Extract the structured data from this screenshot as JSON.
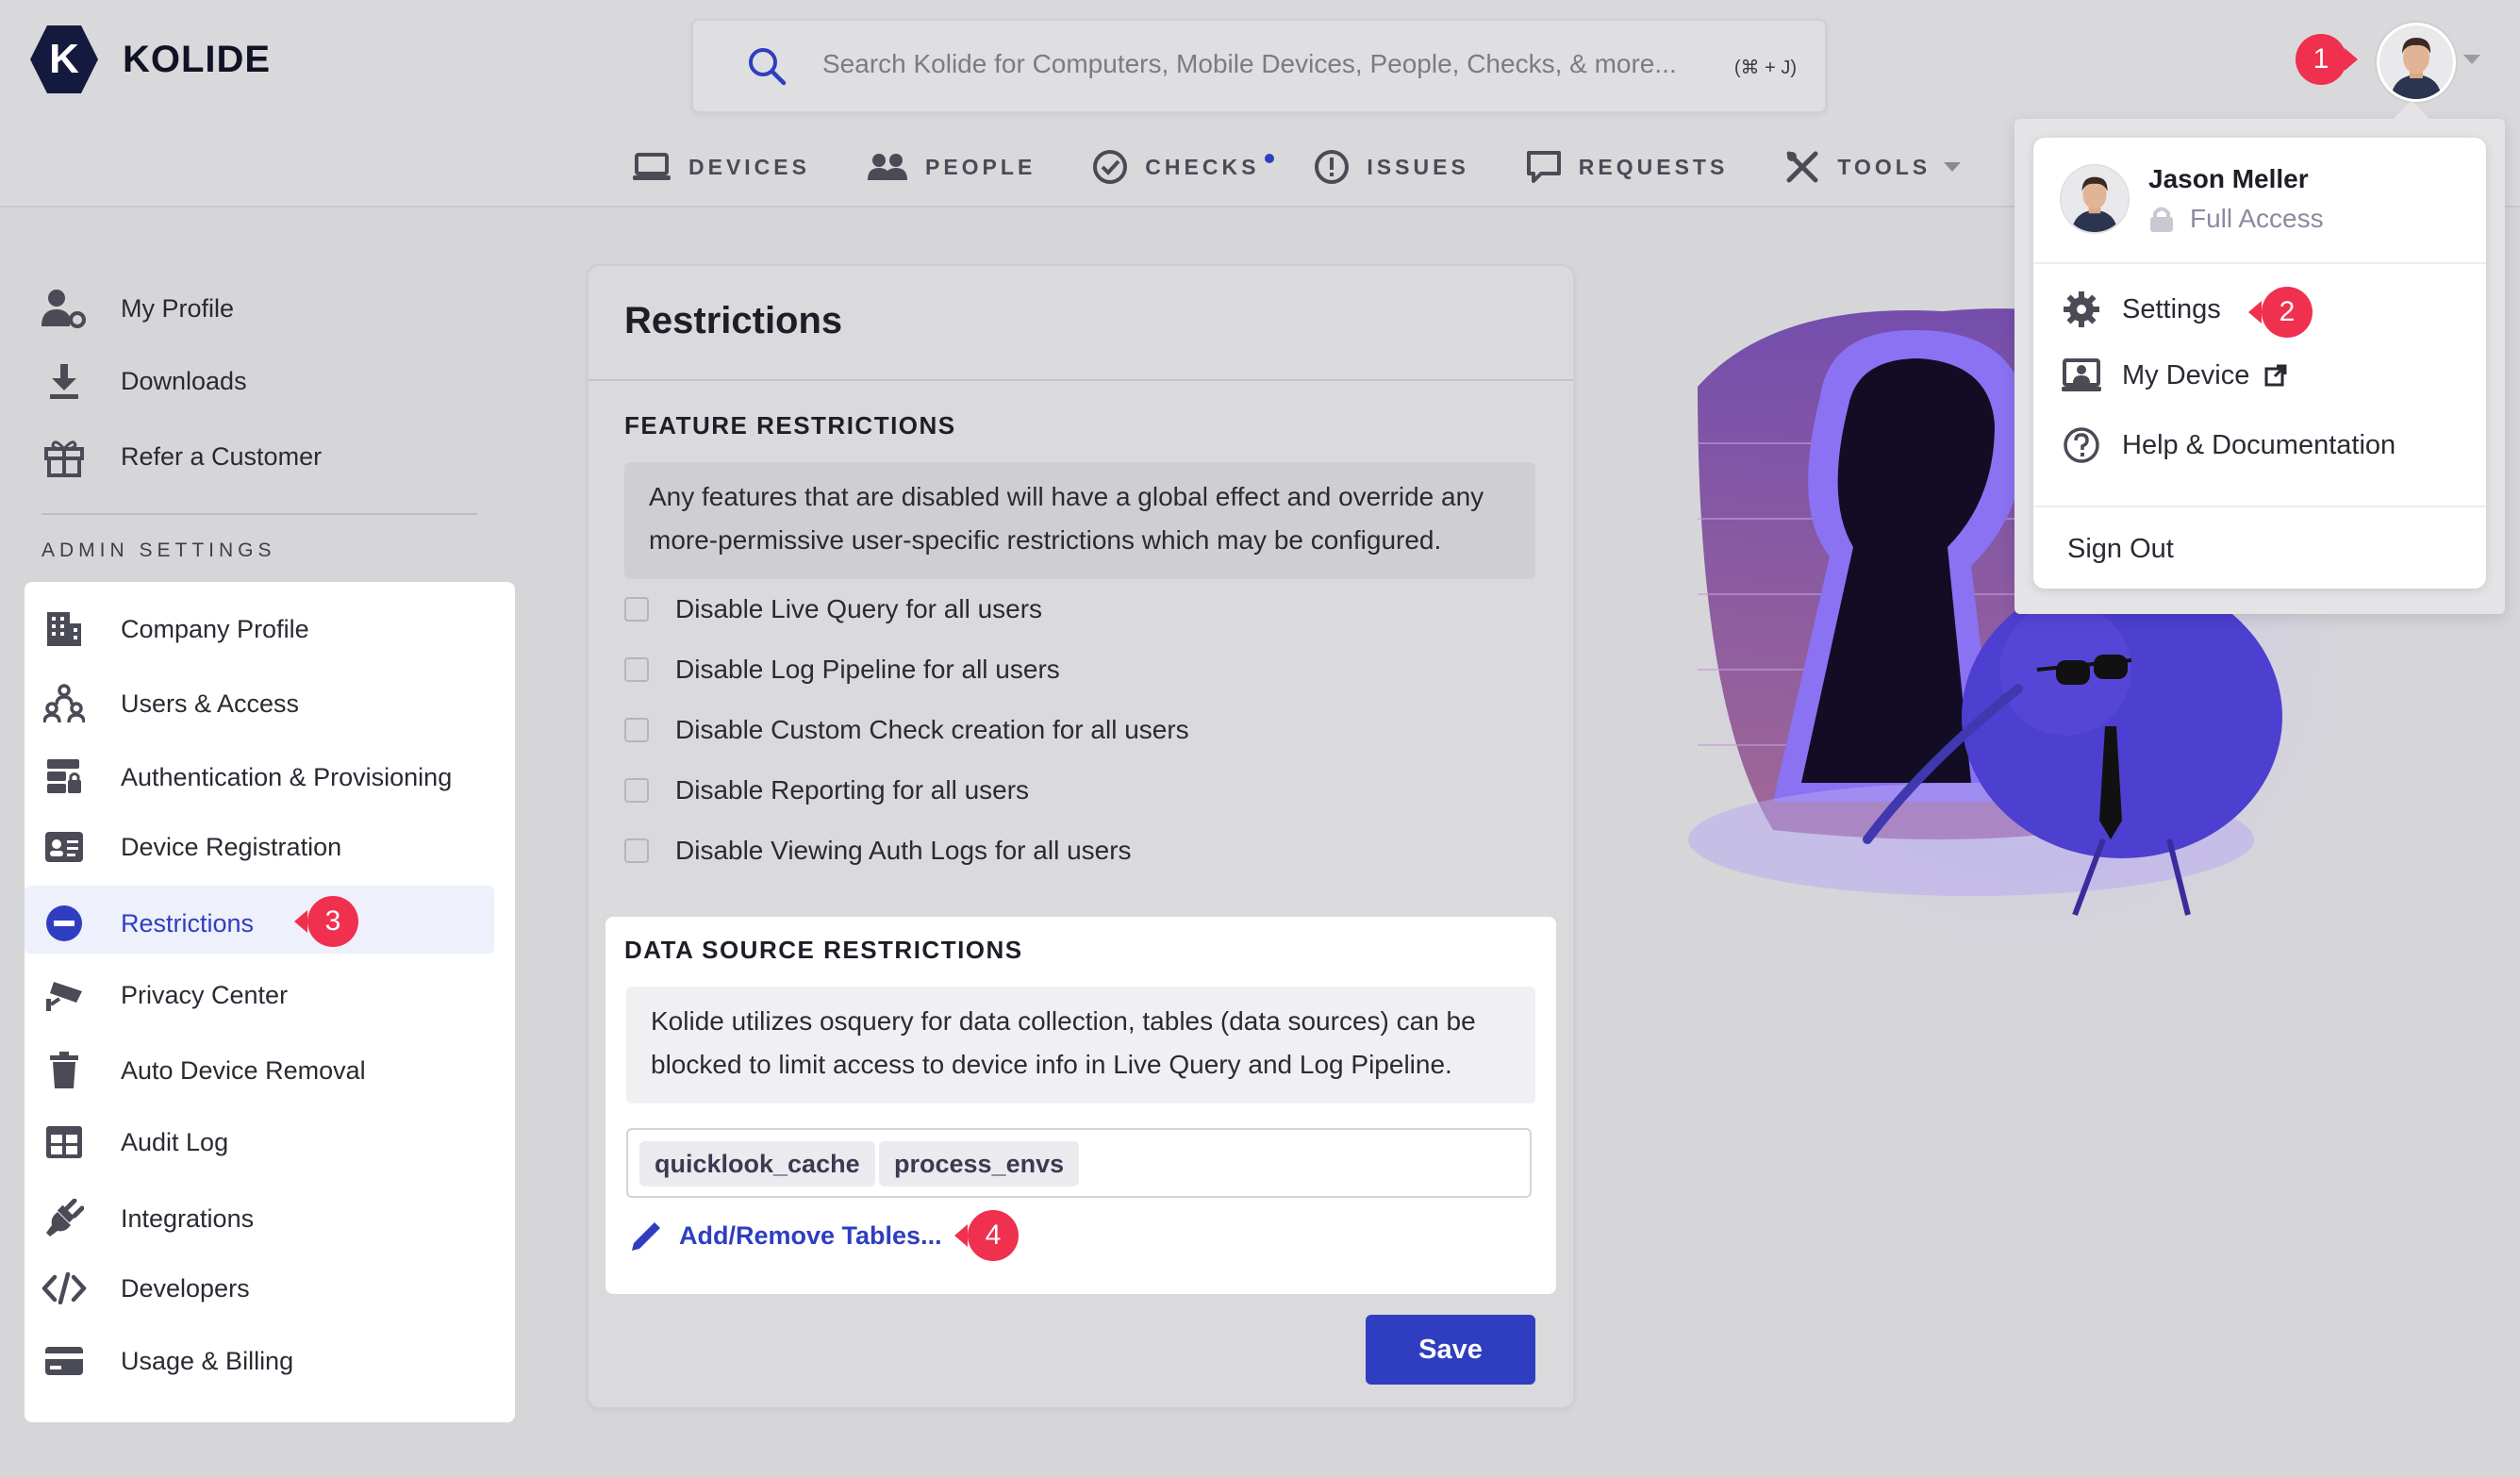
{
  "app": {
    "logo_text": "KOLIDE",
    "logo_letter": "K"
  },
  "search": {
    "placeholder": "Search Kolide for Computers, Mobile Devices, People, Checks, & more...",
    "shortcut": "(⌘ + J)"
  },
  "nav": {
    "devices": "DEVICES",
    "people": "PEOPLE",
    "checks": "CHECKS",
    "issues": "ISSUES",
    "requests": "REQUESTS",
    "tools": "TOOLS"
  },
  "sidebar": {
    "my_profile": "My Profile",
    "downloads": "Downloads",
    "refer": "Refer a Customer",
    "admin_heading": "ADMIN SETTINGS",
    "admin_items": [
      "Company Profile",
      "Users & Access",
      "Authentication & Provisioning",
      "Device Registration",
      "Restrictions",
      "Privacy Center",
      "Auto Device Removal",
      "Audit Log",
      "Integrations",
      "Developers",
      "Usage & Billing"
    ]
  },
  "main": {
    "title": "Restrictions",
    "feature": {
      "heading": "FEATURE RESTRICTIONS",
      "notice": "Any features that are disabled will have a global effect and override any more-permissive user-specific restrictions which may be configured.",
      "options": [
        "Disable Live Query for all users",
        "Disable Log Pipeline for all users",
        "Disable Custom Check creation for all users",
        "Disable Reporting for all users",
        "Disable Viewing Auth Logs for all users"
      ]
    },
    "datasource": {
      "heading": "DATA SOURCE RESTRICTIONS",
      "notice": "Kolide utilizes osquery for data collection, tables (data sources) can be blocked to limit access to device info in Live Query and Log Pipeline.",
      "tags": [
        "quicklook_cache",
        "process_envs"
      ],
      "add_link": "Add/Remove Tables..."
    },
    "save_label": "Save"
  },
  "user_menu": {
    "name": "Jason Meller",
    "access": "Full Access",
    "settings": "Settings",
    "my_device": "My Device",
    "help": "Help & Documentation",
    "sign_out": "Sign Out"
  },
  "annotations": [
    "1",
    "2",
    "3",
    "4"
  ],
  "colors": {
    "accent": "#2f3ec0",
    "badge": "#f0304f",
    "illustration": "#6b57e6"
  }
}
